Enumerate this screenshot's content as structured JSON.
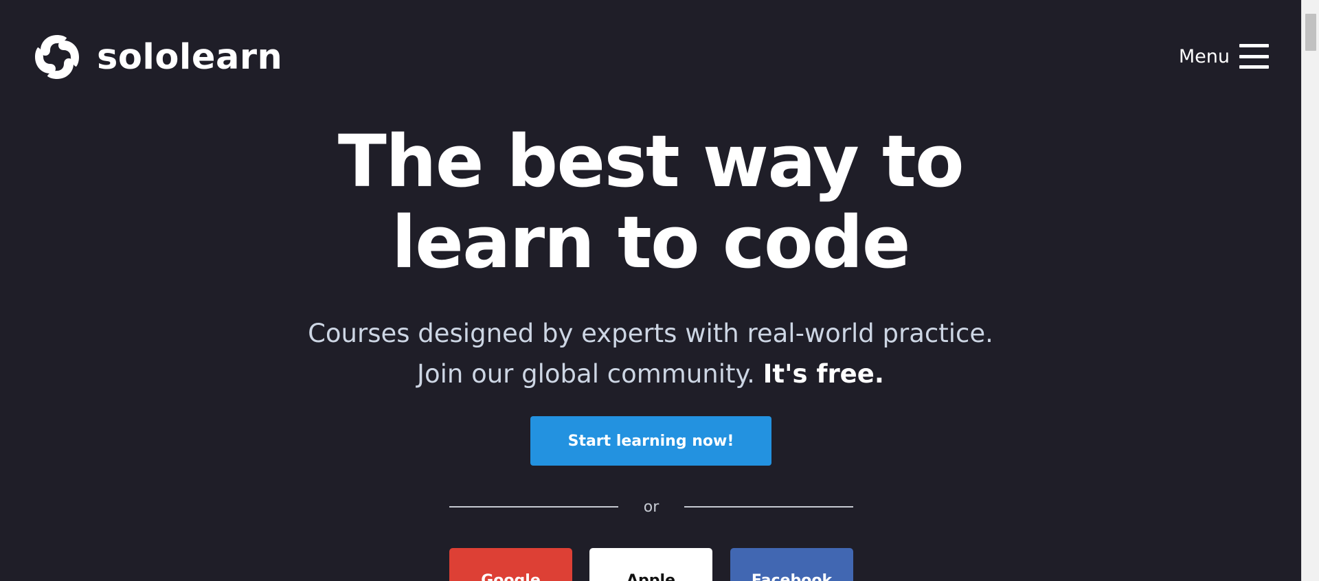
{
  "header": {
    "brand_name": "sololearn",
    "logo_icon": "sololearn-swirl-logo-icon",
    "menu_label": "Menu",
    "menu_icon": "hamburger-menu-icon"
  },
  "hero": {
    "title_line1": "The best way to",
    "title_line2": "learn to code",
    "subtitle_line1": "Courses designed by experts with real-world practice.",
    "subtitle_line2": "Join our global community.",
    "subtitle_emphasis": "It's free.",
    "cta_label": "Start learning now!",
    "divider_text": "or"
  },
  "social_login": {
    "google_label": "Google",
    "apple_label": "Apple",
    "facebook_label": "Facebook"
  },
  "colors": {
    "background": "#1f1e28",
    "cta_blue": "#2392e0",
    "google_red": "#dd4035",
    "apple_white": "#ffffff",
    "facebook_blue": "#4167b2"
  }
}
